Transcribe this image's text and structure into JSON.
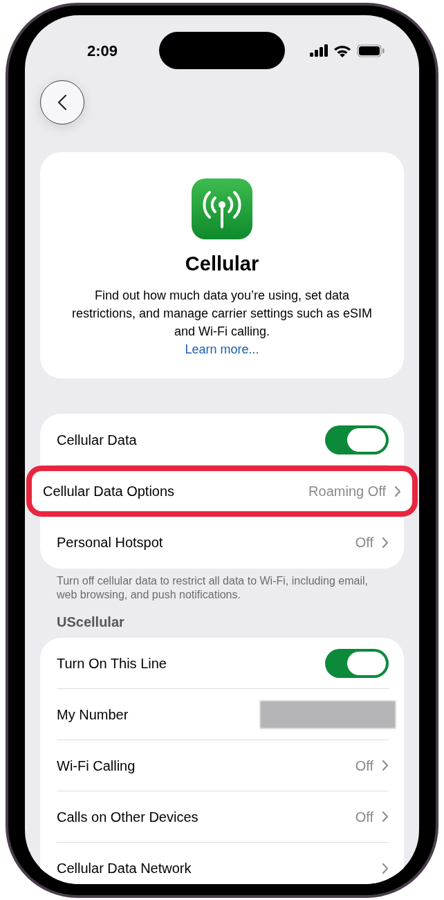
{
  "status_bar": {
    "time": "2:09"
  },
  "header": {
    "title": "Cellular",
    "description": "Find out how much data you’re using, set data restrictions, and manage carrier settings such as eSIM and Wi-Fi calling.",
    "link": "Learn more..."
  },
  "sections": [
    {
      "rows": [
        {
          "kind": "toggle",
          "label": "Cellular Data",
          "on": true,
          "highlighted": false
        },
        {
          "kind": "link",
          "label": "Cellular Data Options",
          "value": "Roaming Off",
          "highlighted": true
        },
        {
          "kind": "link",
          "label": "Personal Hotspot",
          "value": "Off",
          "highlighted": false
        }
      ],
      "footer": "Turn off cellular data to restrict all data to Wi-Fi, including email, web browsing, and push notifications."
    },
    {
      "title": "UScellular",
      "rows": [
        {
          "kind": "toggle",
          "label": "Turn On This Line",
          "on": true,
          "highlighted": false
        },
        {
          "kind": "redacted",
          "label": "My Number",
          "highlighted": false
        },
        {
          "kind": "link",
          "label": "Wi-Fi Calling",
          "value": "Off",
          "highlighted": false
        },
        {
          "kind": "link",
          "label": "Calls on Other Devices",
          "value": "Off",
          "highlighted": false
        },
        {
          "kind": "link",
          "label": "Cellular Data Network",
          "highlighted": false
        }
      ]
    }
  ]
}
